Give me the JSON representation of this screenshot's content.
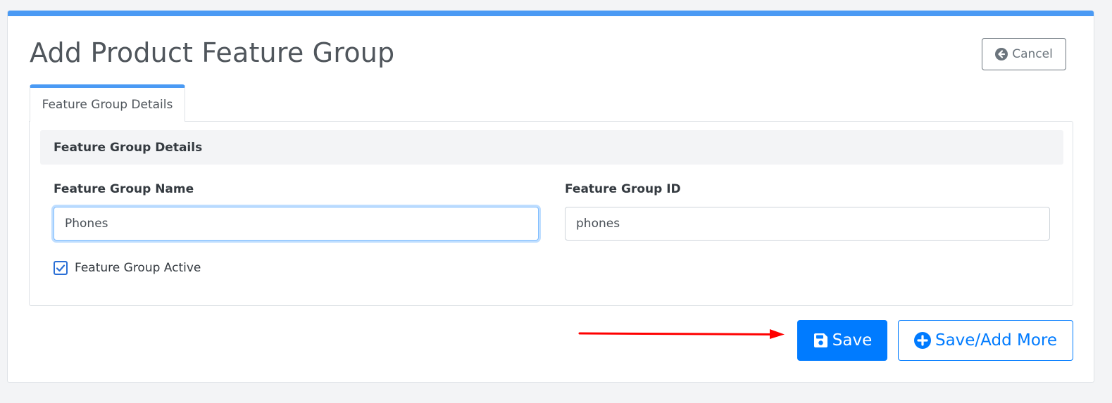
{
  "colors": {
    "accent": "#4a9af4",
    "primary": "#007bff",
    "annotation_arrow": "#ff0000"
  },
  "header": {
    "title": "Add Product Feature Group",
    "cancel": {
      "label": "Cancel",
      "icon": "circle-arrow-left-icon"
    }
  },
  "tabs": [
    {
      "label": "Feature Group Details",
      "active": true
    }
  ],
  "section": {
    "title": "Feature Group Details"
  },
  "form": {
    "name": {
      "label": "Feature Group Name",
      "value": "Phones",
      "focused": true
    },
    "id": {
      "label": "Feature Group ID",
      "value": "phones"
    },
    "active": {
      "label": "Feature Group Active",
      "checked": true
    }
  },
  "actions": {
    "save": {
      "label": "Save",
      "icon": "floppy-disk-icon"
    },
    "save_add_more": {
      "label": "Save/Add More",
      "icon": "plus-circle-icon"
    }
  },
  "annotation": {
    "arrow_icon": "red-arrow-right-icon"
  }
}
